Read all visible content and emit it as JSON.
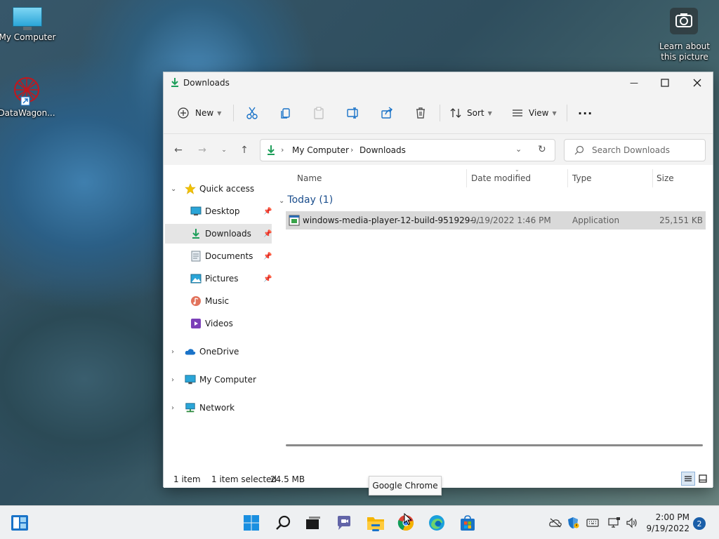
{
  "desktop": {
    "icons": [
      {
        "label": "My Computer"
      },
      {
        "label": "DataWagon..."
      }
    ],
    "spotlight": {
      "label_line1": "Learn about",
      "label_line2": "this picture"
    }
  },
  "window": {
    "title": "Downloads",
    "controls": {
      "minimize": "—",
      "maximize": "☐",
      "close": "✕"
    }
  },
  "toolbar": {
    "new_label": "New",
    "sort_label": "Sort",
    "view_label": "View",
    "more_label": "···"
  },
  "address": {
    "crumbs": [
      "My Computer",
      "Downloads"
    ],
    "search_placeholder": "Search Downloads"
  },
  "sidebar": {
    "quick_access": "Quick access",
    "items": [
      {
        "label": "Desktop",
        "icon": "desktop-icon",
        "pinned": true
      },
      {
        "label": "Downloads",
        "icon": "download-icon",
        "pinned": true,
        "selected": true
      },
      {
        "label": "Documents",
        "icon": "document-icon",
        "pinned": true
      },
      {
        "label": "Pictures",
        "icon": "pictures-icon",
        "pinned": true
      },
      {
        "label": "Music",
        "icon": "music-icon",
        "pinned": false
      },
      {
        "label": "Videos",
        "icon": "videos-icon",
        "pinned": false
      }
    ],
    "roots": [
      {
        "label": "OneDrive",
        "icon": "cloud-icon"
      },
      {
        "label": "My Computer",
        "icon": "computer-icon"
      },
      {
        "label": "Network",
        "icon": "network-icon"
      }
    ]
  },
  "content": {
    "columns": [
      "Name",
      "Date modified",
      "Type",
      "Size"
    ],
    "group_label": "Today (1)",
    "files": [
      {
        "name": "windows-media-player-12-build-951929-...",
        "date": "9/19/2022 1:46 PM",
        "type": "Application",
        "size": "25,151 KB"
      }
    ]
  },
  "status": {
    "count": "1 item",
    "selected": "1 item selected",
    "size": "24.5 MB"
  },
  "tooltip": "Google Chrome",
  "taskbar": {
    "time": "2:00 PM",
    "date": "9/19/2022",
    "notifications": "2"
  },
  "colors": {
    "accent": "#1a73c8",
    "download_green": "#1e9e5a",
    "selected_row": "#d9d9d9"
  }
}
